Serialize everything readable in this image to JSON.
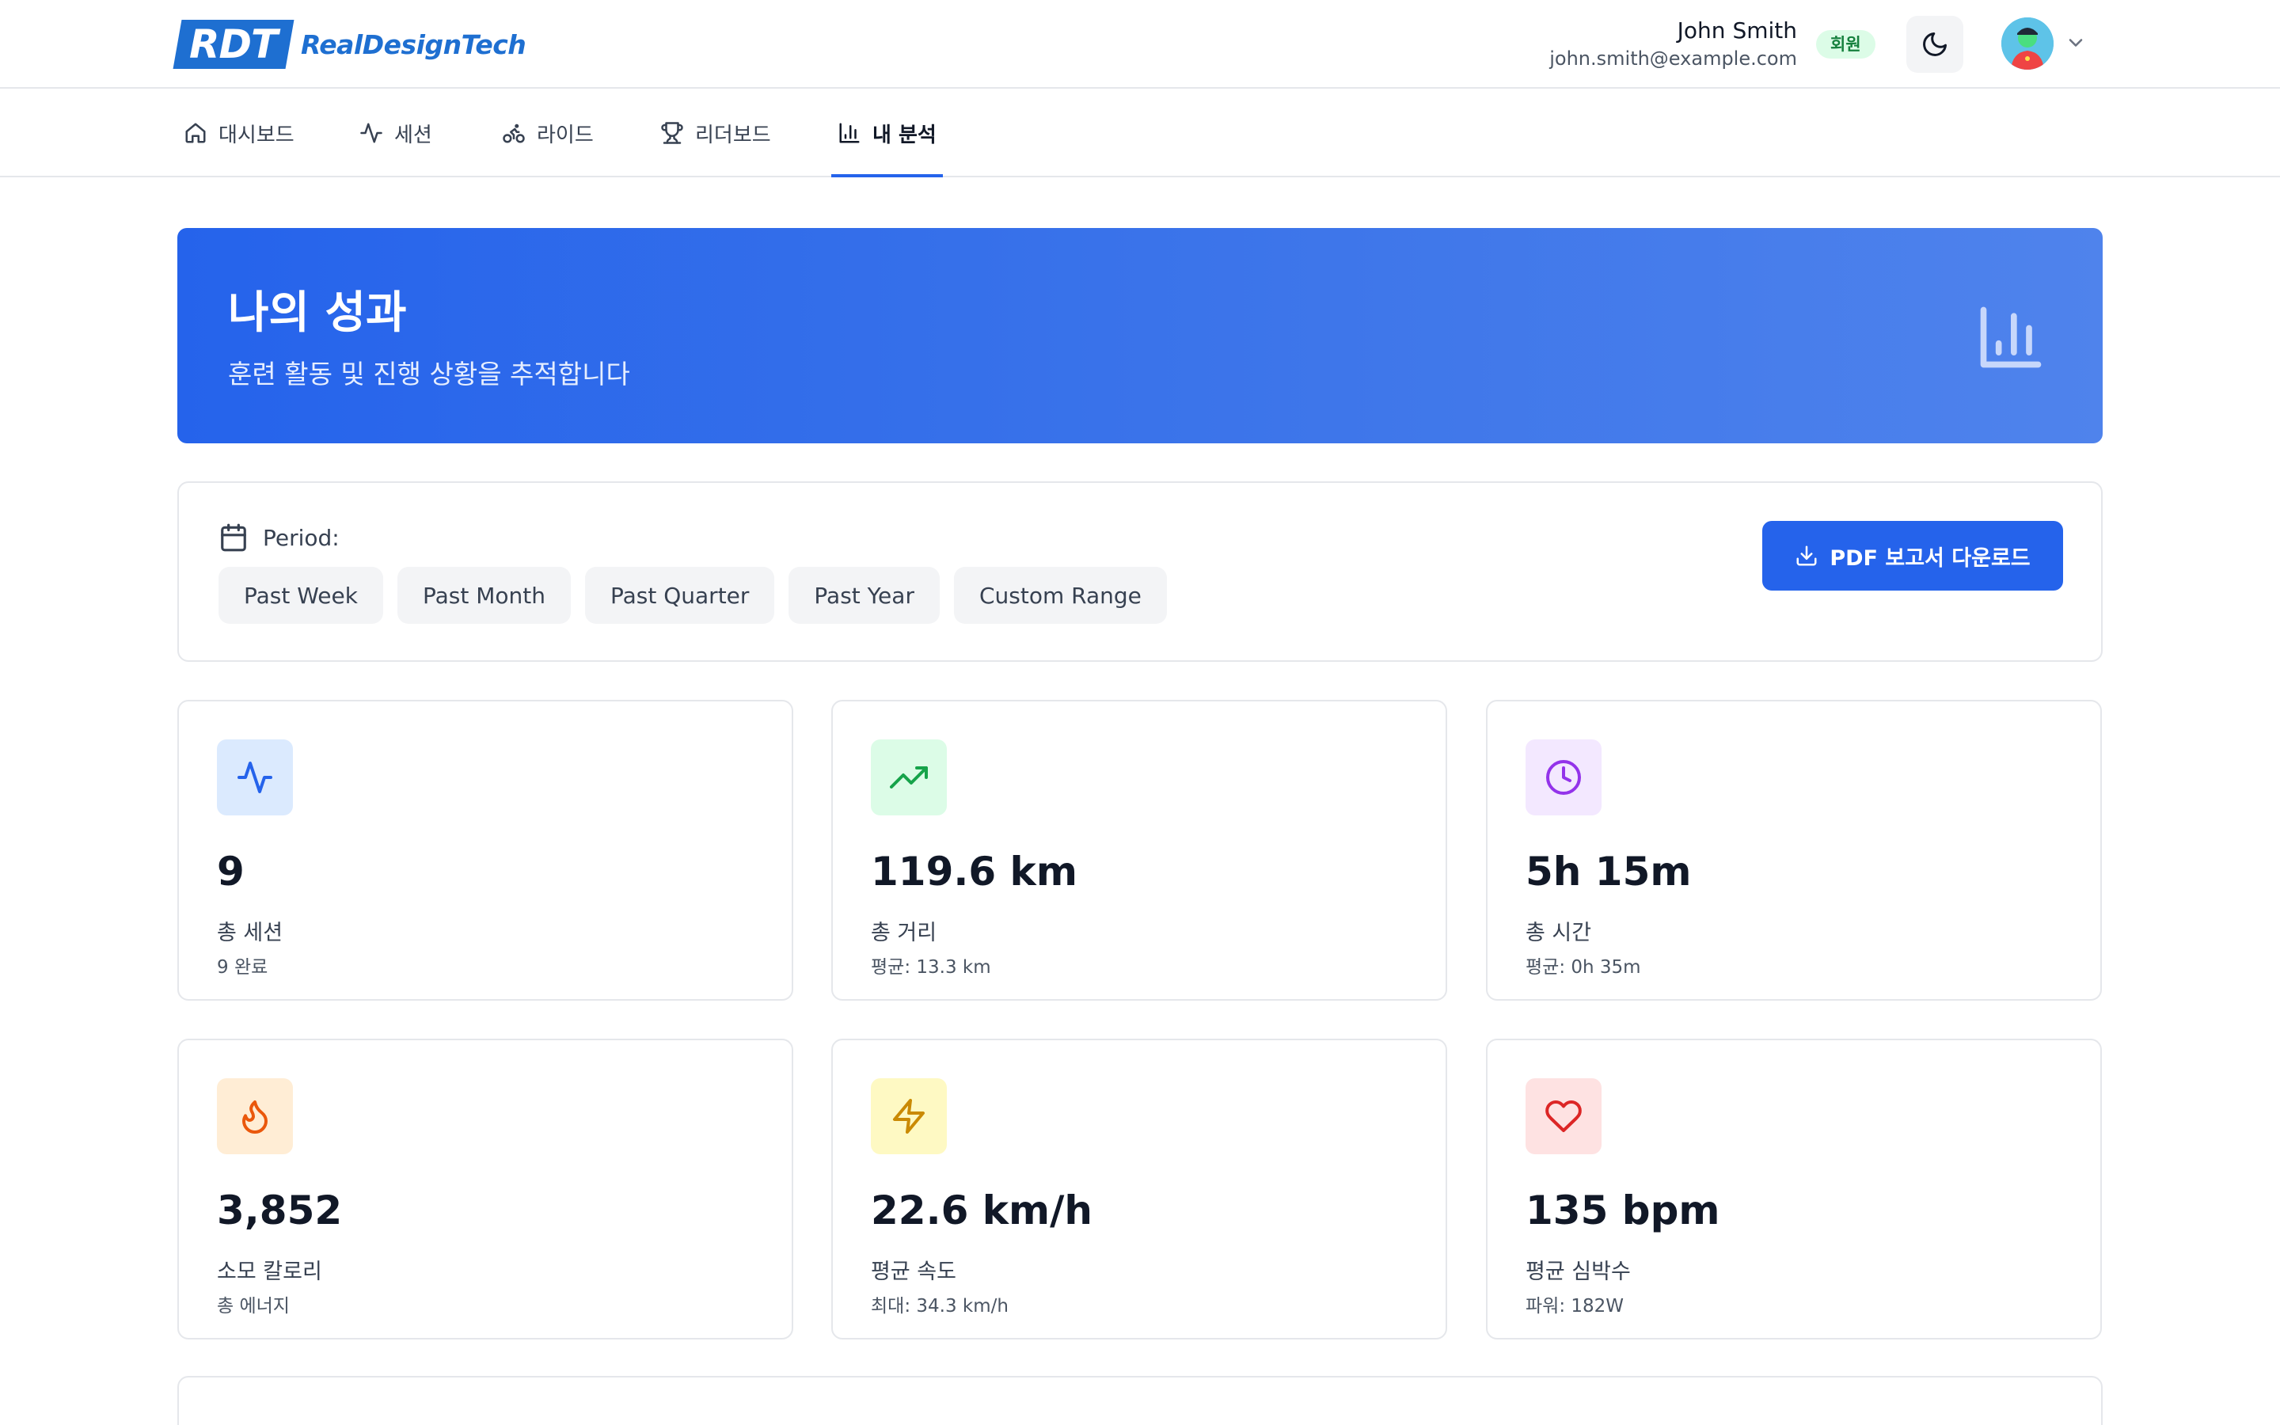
{
  "brand": {
    "mark": "RDT",
    "name": "RealDesignTech",
    "color": "#1e6fd1"
  },
  "user": {
    "name": "John Smith",
    "email": "john.smith@example.com",
    "role_badge": "회원"
  },
  "nav": {
    "items": [
      {
        "label": "대시보드",
        "icon": "home-icon"
      },
      {
        "label": "세션",
        "icon": "activity-icon"
      },
      {
        "label": "라이드",
        "icon": "bike-icon"
      },
      {
        "label": "리더보드",
        "icon": "trophy-icon"
      },
      {
        "label": "내 분석",
        "icon": "bar-chart-icon",
        "active": true
      }
    ]
  },
  "hero": {
    "title": "나의 성과",
    "subtitle": "훈련 활동 및 진행 상황을 추적합니다"
  },
  "period": {
    "label": "Period:",
    "options": [
      "Past Week",
      "Past Month",
      "Past Quarter",
      "Past Year",
      "Custom Range"
    ],
    "download_label": "PDF 보고서 다운로드"
  },
  "stats": [
    {
      "value": "9",
      "label": "총 세션",
      "sub": "9 완료",
      "icon": "activity-icon",
      "color": "#2563eb",
      "bg": "#dbeafe"
    },
    {
      "value": "119.6 km",
      "label": "총 거리",
      "sub": "평균: 13.3 km",
      "icon": "trending-up-icon",
      "color": "#16a34a",
      "bg": "#dcfce7"
    },
    {
      "value": "5h 15m",
      "label": "총 시간",
      "sub": "평균: 0h 35m",
      "icon": "clock-icon",
      "color": "#9333ea",
      "bg": "#f3e8ff"
    },
    {
      "value": "3,852",
      "label": "소모 칼로리",
      "sub": "총 에너지",
      "icon": "flame-icon",
      "color": "#ea580c",
      "bg": "#ffedd5"
    },
    {
      "value": "22.6 km/h",
      "label": "평균 속도",
      "sub": "최대: 34.3 km/h",
      "icon": "zap-icon",
      "color": "#ca8a04",
      "bg": "#fef9c3"
    },
    {
      "value": "135 bpm",
      "label": "평균 심박수",
      "sub": "파워: 182W",
      "icon": "heart-icon",
      "color": "#dc2626",
      "bg": "#fee2e2"
    }
  ]
}
